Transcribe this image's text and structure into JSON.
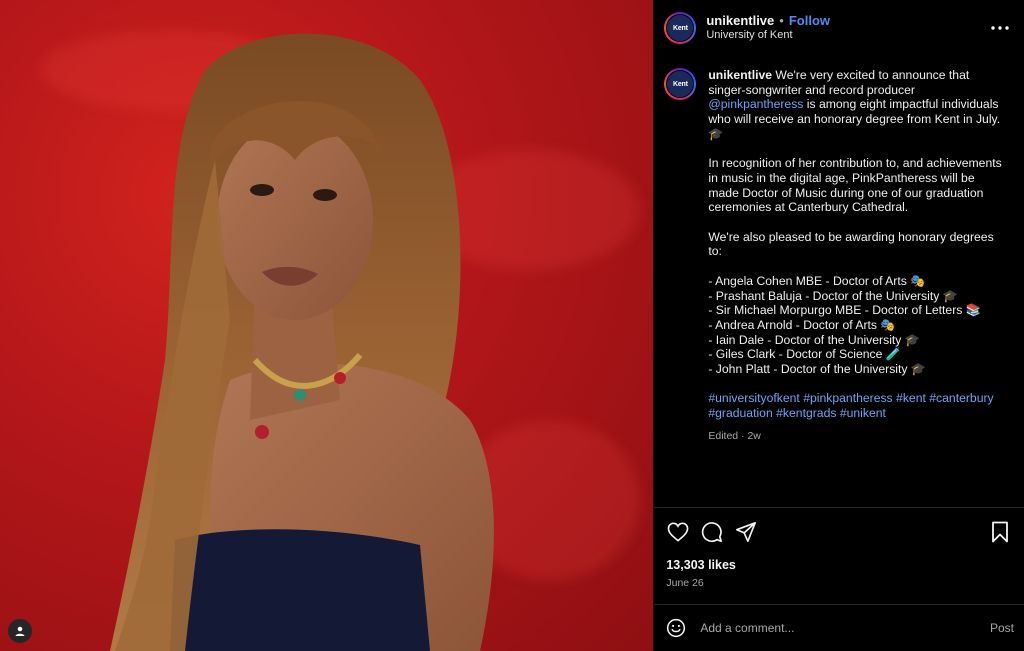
{
  "header": {
    "username": "unikentlive",
    "separator": "•",
    "follow_label": "Follow",
    "location": "University of Kent"
  },
  "avatar": {
    "text": "Kent"
  },
  "caption": {
    "username": "unikentlive",
    "line1_pre": "We're very excited to announce that singer-songwriter and record producer ",
    "mention": "@pinkpantheress",
    "line1_post": " is among eight impactful individuals who will receive an honorary degree from Kent in July. 🎓",
    "para2": "In recognition of her contribution to, and achievements in music in the digital age, PinkPantheress will be made Doctor of Music during one of our graduation ceremonies at Canterbury Cathedral.",
    "para3": "We're also pleased to be awarding honorary degrees to:",
    "list": [
      "- Angela Cohen MBE - Doctor of Arts 🎭",
      "- Prashant Baluja - Doctor of the University 🎓",
      "- Sir Michael Morpurgo MBE - Doctor of Letters 📚",
      "- Andrea Arnold - Doctor of Arts 🎭",
      "- Iain Dale - Doctor of the University 🎓",
      "- Giles Clark - Doctor of Science 🧪",
      "- John Platt - Doctor of the University 🎓"
    ],
    "hashtags": [
      "#universityofkent",
      "#pinkpantheress",
      "#kent",
      "#canterbury",
      "#graduation",
      "#kentgrads",
      "#unikent"
    ],
    "meta": "Edited · 2w"
  },
  "engagement": {
    "likes": "13,303 likes",
    "date": "June 26"
  },
  "comment": {
    "placeholder": "Add a comment...",
    "post_label": "Post"
  },
  "icons": {
    "more": "more-horizontal-icon",
    "like": "heart-icon",
    "comment": "comment-icon",
    "share": "send-icon",
    "save": "bookmark-icon",
    "emoji": "emoji-icon",
    "tags": "user-tag-icon"
  },
  "colors": {
    "background": "#000000",
    "accent_link": "#6ea4f5",
    "follow": "#4f8cf4",
    "muted": "#a8a8a8",
    "photo_backdrop": "#b5171a"
  }
}
